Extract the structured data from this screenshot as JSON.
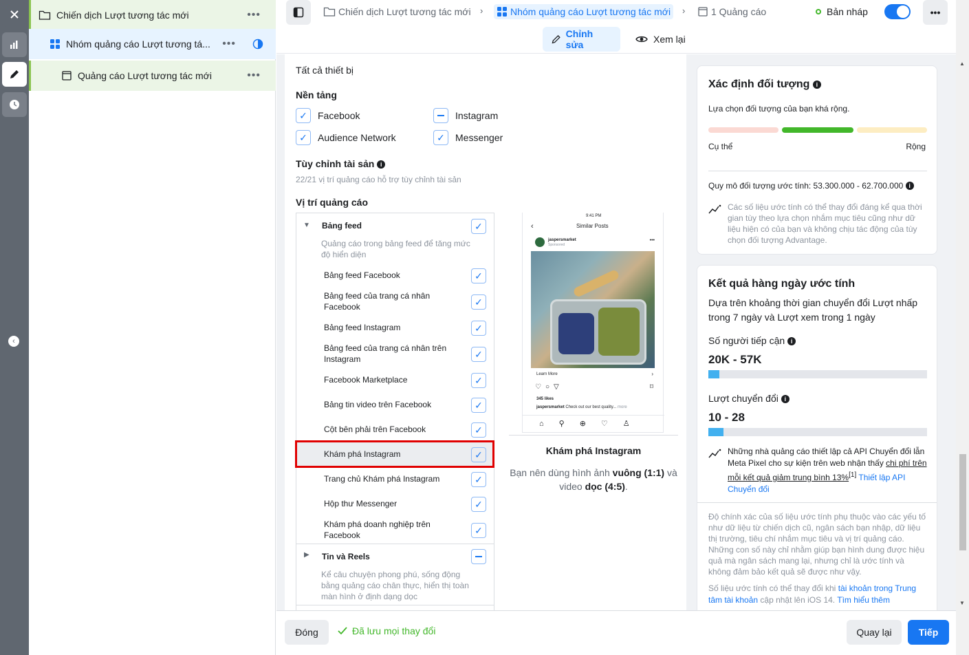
{
  "tree": {
    "campaign": "Chiến dịch Lượt tương tác mới",
    "adset": "Nhóm quảng cáo Lượt tương tá...",
    "ad": "Quảng cáo Lượt tương tác mới",
    "more": "•••"
  },
  "header": {
    "crumb_campaign": "Chiến dịch Lượt tương tác mới",
    "crumb_adset": "Nhóm quảng cáo Lượt tương tác mới",
    "crumb_ad": "1 Quảng cáo",
    "status": "Bản nháp",
    "more": "•••",
    "tab_edit": "Chỉnh sửa",
    "tab_review": "Xem lại"
  },
  "placements": {
    "devices": "Tất cả thiết bị",
    "platforms_title": "Nền tảng",
    "platforms": [
      {
        "label": "Facebook",
        "state": "checked"
      },
      {
        "label": "Instagram",
        "state": "partial"
      },
      {
        "label": "Audience Network",
        "state": "checked"
      },
      {
        "label": "Messenger",
        "state": "checked"
      }
    ],
    "asset_title": "Tùy chỉnh tài sản",
    "asset_sub": "22/21 vị trí quảng cáo hỗ trợ tùy chỉnh tài sản",
    "positions_title": "Vị trí quảng cáo",
    "feed_group": "Bảng feed",
    "feed_desc": "Quảng cáo trong bảng feed để tăng mức độ hiển diện",
    "feed_items": [
      "Bảng feed Facebook",
      "Bảng feed của trang cá nhân Facebook",
      "Bảng feed Instagram",
      "Bảng feed của trang cá nhân trên Instagram",
      "Facebook Marketplace",
      "Bảng tin video trên Facebook",
      "Cột bên phải trên Facebook",
      "Khám phá Instagram",
      "Trang chủ Khám phá Instagram",
      "Hộp thư Messenger",
      "Khám phá doanh nghiệp trên Facebook"
    ],
    "stories_group": "Tin và Reels",
    "stories_desc": "Kể câu chuyện phong phú, sống động bằng quảng cáo chân thực, hiển thị toàn màn hình ở định dạng dọc"
  },
  "preview": {
    "time": "9:41 PM",
    "screen_title": "Similar Posts",
    "account": "jaspersmarket",
    "sponsored": "Sponsored",
    "cta": "Learn More",
    "likes": "345 likes",
    "caption_user": "jaspersmarket",
    "caption": "Check out our best quality...",
    "caption_more": "more",
    "title": "Khám phá Instagram",
    "desc_1": "Bạn nên dùng hình ảnh",
    "desc_bold_1": "vuông (1:1)",
    "desc_2": "và video",
    "desc_bold_2": "dọc (4:5)",
    "desc_end": "."
  },
  "audience": {
    "title": "Xác định đối tượng",
    "subtitle": "Lựa chọn đối tượng của bạn khá rộng.",
    "specific": "Cụ thể",
    "broad": "Rộng",
    "size": "Quy mô đối tượng ước tính: 53.300.000 - 62.700.000",
    "note": "Các số liệu ước tính có thể thay đổi đáng kể qua thời gian tùy theo lựa chọn nhắm mục tiêu cũng như dữ liệu hiện có của bạn và không chịu tác động của tùy chọn đối tượng Advantage."
  },
  "results": {
    "title": "Kết quả hàng ngày ước tính",
    "subtitle": "Dựa trên khoảng thời gian chuyển đổi Lượt nhấp trong 7 ngày và Lượt xem trong 1 ngày",
    "reach_label": "Số người tiếp cận",
    "reach_value": "20K - 57K",
    "reach_fill": 0.05,
    "conv_label": "Lượt chuyển đổi",
    "conv_value": "10 - 28",
    "conv_fill": 0.07,
    "api_note_1": "Những nhà quảng cáo thiết lập cả API Chuyển đổi lẫn Meta Pixel cho sự kiện trên web nhận thấy",
    "api_note_underline": "chi phí trên mỗi kết quả giảm trung bình 13%",
    "api_note_sup": "[1]",
    "api_link": "Thiết lập API Chuyển đổi",
    "accuracy": "Độ chính xác của số liệu ước tính phụ thuộc vào các yếu tố như dữ liệu từ chiến dịch cũ, ngân sách bạn nhập, dữ liệu thị trường, tiêu chí nhắm mục tiêu và vị trí quảng cáo. Những con số này chỉ nhằm giúp bạn hình dung được hiệu quả mà ngân sách mang lại, nhưng chỉ là ước tính và không đảm bảo kết quả sẽ được như vậy.",
    "ios_1": "Số liệu ước tính có thể thay đổi khi",
    "ios_link1": "tài khoản trong Trung tâm tài khoản",
    "ios_2": "cập nhật lên iOS 14.",
    "ios_link2": "Tìm hiểu thêm"
  },
  "footer": {
    "close": "Đóng",
    "saved": "Đã lưu mọi thay đổi",
    "back": "Quay lại",
    "next": "Tiếp"
  }
}
